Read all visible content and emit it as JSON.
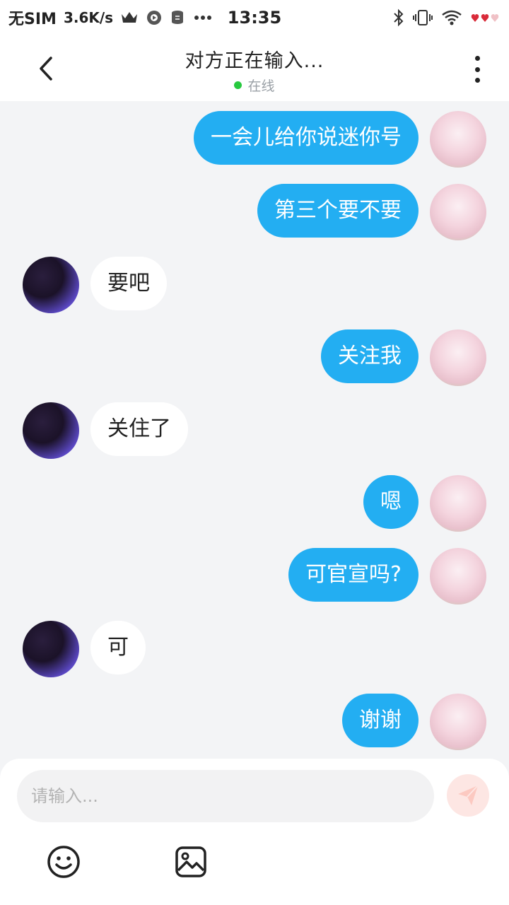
{
  "status_bar": {
    "carrier": "无SIM",
    "speed": "3.6K/s",
    "time": "13:35",
    "icons": [
      "crown-icon",
      "record-icon",
      "data-icon",
      "more-dots-icon",
      "bluetooth-icon",
      "vibrate-icon",
      "wifi-icon",
      "hearts-icon"
    ]
  },
  "header": {
    "title": "对方正在输入...",
    "status": "在线",
    "status_color": "#27c93f",
    "back_icon": "chevron-left-icon",
    "more_icon": "more-vertical-icon"
  },
  "messages": [
    {
      "sender": "me",
      "text": "一会儿给你说迷你号"
    },
    {
      "sender": "me",
      "text": "第三个要不要"
    },
    {
      "sender": "other",
      "text": "要吧"
    },
    {
      "sender": "me",
      "text": "关注我"
    },
    {
      "sender": "other",
      "text": "关住了"
    },
    {
      "sender": "me",
      "text": "嗯"
    },
    {
      "sender": "me",
      "text": "可官宣吗?"
    },
    {
      "sender": "other",
      "text": "可"
    },
    {
      "sender": "me",
      "text": "谢谢"
    }
  ],
  "composer": {
    "placeholder": "请输入...",
    "send_icon": "send-icon",
    "emoji_icon": "emoji-icon",
    "image_icon": "image-icon"
  },
  "colors": {
    "my_bubble": "#23aef2",
    "other_bubble": "#ffffff",
    "background": "#f3f4f6",
    "send_button": "#fde6e3"
  }
}
